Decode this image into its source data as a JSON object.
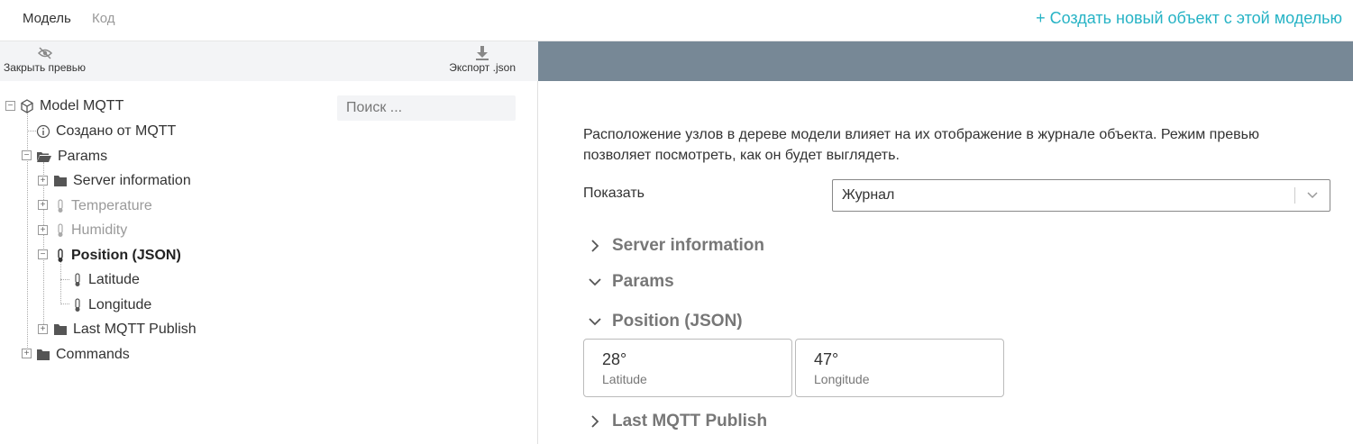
{
  "header": {
    "tabs": [
      {
        "label": "Модель",
        "active": true
      },
      {
        "label": "Код",
        "active": false
      }
    ],
    "create_link": "+ Создать новый объект с этой моделью"
  },
  "toolbar": {
    "close_preview": "Закрыть превью",
    "export": "Экспорт .json"
  },
  "search": {
    "placeholder": "Поиск ..."
  },
  "tree": {
    "root": "Model MQTT",
    "created": "Создано от MQTT",
    "params": "Params",
    "server_info": "Server information",
    "temperature": "Temperature",
    "humidity": "Humidity",
    "position": "Position (JSON)",
    "latitude": "Latitude",
    "longitude": "Longitude",
    "last_publish": "Last MQTT Publish",
    "commands": "Commands"
  },
  "preview": {
    "description": "Расположение узлов в дереве модели влияет на их отображение в журнале объекта. Режим превью позволяет посмотреть, как он будет выглядеть.",
    "show_label": "Показать",
    "show_value": "Журнал",
    "sections": {
      "server_info": "Server information",
      "params": "Params",
      "position": "Position (JSON)",
      "last_publish": "Last MQTT Publish"
    },
    "cards": [
      {
        "value": "28°",
        "label": "Latitude"
      },
      {
        "value": "47°",
        "label": "Longitude"
      }
    ]
  },
  "colors": {
    "accent": "#26b3c5",
    "header_band": "#778896",
    "toolbar_bg": "#f3f4f6"
  }
}
